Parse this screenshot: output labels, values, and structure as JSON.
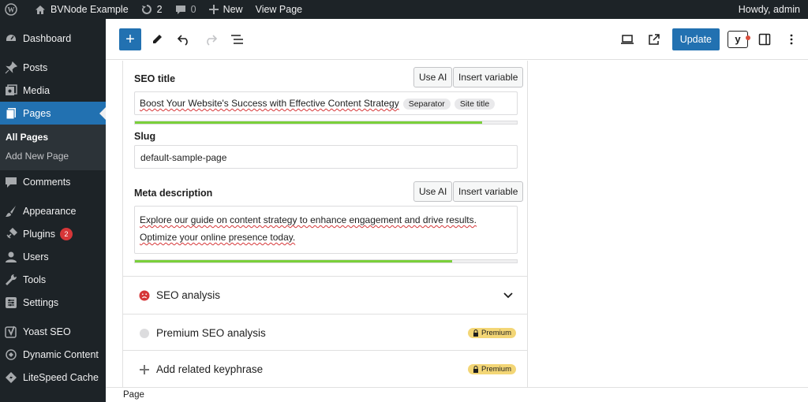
{
  "adminbar": {
    "site_name": "BVNode Example",
    "updates_count": "2",
    "comments_count": "0",
    "new_label": "New",
    "view_page_label": "View Page",
    "howdy": "Howdy, admin"
  },
  "sidebar": {
    "items": [
      {
        "label": "Dashboard",
        "icon": "dashboard-icon"
      },
      {
        "label": "Posts",
        "icon": "pin-icon"
      },
      {
        "label": "Media",
        "icon": "media-icon"
      },
      {
        "label": "Pages",
        "icon": "pages-icon"
      },
      {
        "label": "Comments",
        "icon": "comment-icon"
      },
      {
        "label": "Appearance",
        "icon": "brush-icon"
      },
      {
        "label": "Plugins",
        "icon": "plug-icon",
        "badge": "2"
      },
      {
        "label": "Users",
        "icon": "user-icon"
      },
      {
        "label": "Tools",
        "icon": "wrench-icon"
      },
      {
        "label": "Settings",
        "icon": "settings-icon"
      },
      {
        "label": "Yoast SEO",
        "icon": "yoast-icon"
      },
      {
        "label": "Dynamic Content",
        "icon": "dynamic-icon"
      },
      {
        "label": "LiteSpeed Cache",
        "icon": "litespeed-icon"
      }
    ],
    "submenu": [
      "All Pages",
      "Add New Page"
    ]
  },
  "toolbar": {
    "update_label": "Update"
  },
  "seo": {
    "title_label": "SEO title",
    "use_ai": "Use AI",
    "insert_variable": "Insert variable",
    "title_value": "Boost Your Website's Success with Effective Content Strategy",
    "pill_separator": "Separator",
    "pill_site_title": "Site title",
    "title_progress": 0.91,
    "slug_label": "Slug",
    "slug_value": "default-sample-page",
    "meta_label": "Meta description",
    "meta_line1": "Explore our guide on content strategy to enhance engagement and drive results.",
    "meta_line2": "Optimize your online presence today.",
    "meta_progress": 0.83,
    "seo_analysis": "SEO analysis",
    "premium_seo_analysis": "Premium SEO analysis",
    "related_keyphrase": "Add related keyphrase",
    "premium_badge": "Premium"
  },
  "footer": {
    "breadcrumb": "Page"
  },
  "colors": {
    "accent": "#2271b1",
    "admin_bg": "#1d2327",
    "progress_good": "#7ad03a",
    "premium": "#f3d676",
    "bad": "#d63638"
  }
}
